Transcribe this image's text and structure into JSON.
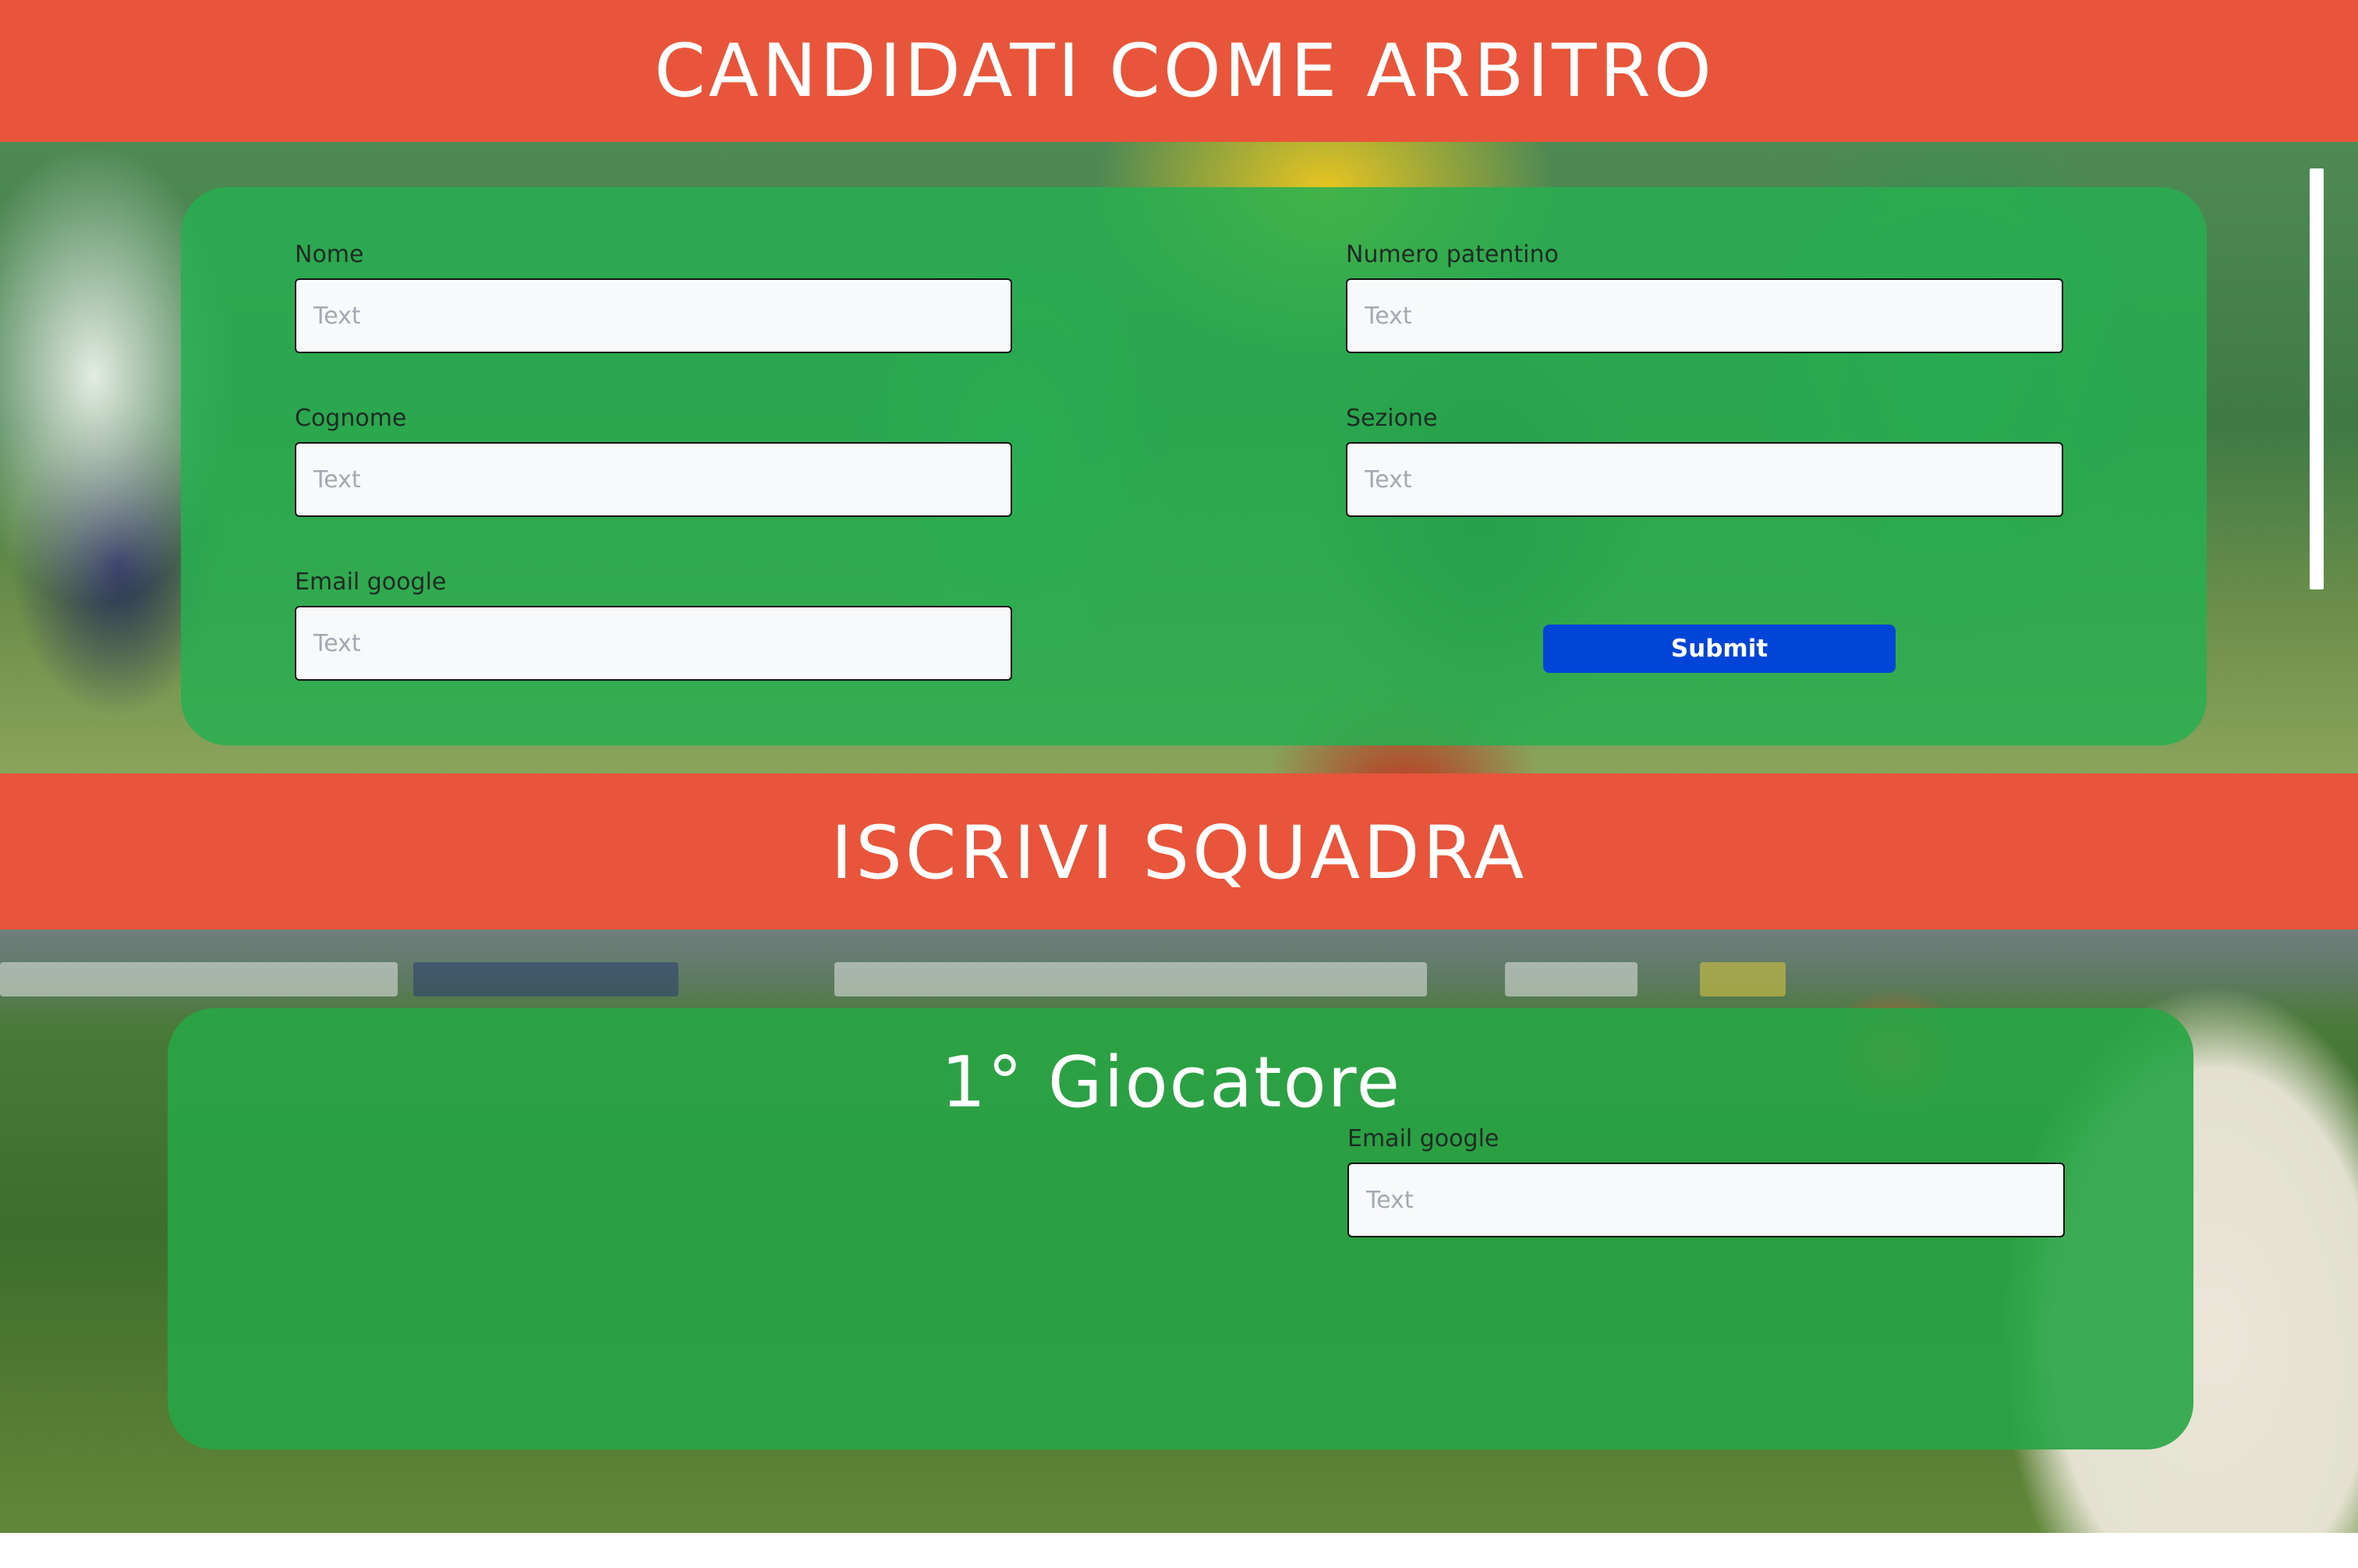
{
  "referee_section": {
    "title": "CANDIDATI COME ARBITRO",
    "fields": {
      "nome": {
        "label": "Nome",
        "placeholder": "Text"
      },
      "cognome": {
        "label": "Cognome",
        "placeholder": "Text"
      },
      "email": {
        "label": "Email google",
        "placeholder": "Text"
      },
      "numero_patentino": {
        "label": "Numero patentino",
        "placeholder": "Text"
      },
      "sezione": {
        "label": "Sezione",
        "placeholder": "Text"
      }
    },
    "submit_label": "Submit"
  },
  "team_section": {
    "title": "ISCRIVI SQUADRA",
    "player_title": "1° Giocatore",
    "fields": {
      "email": {
        "label": "Email google",
        "placeholder": "Text"
      }
    }
  },
  "colors": {
    "band": "#e8553a",
    "panel": "#28af50",
    "submit": "#0045d8"
  }
}
